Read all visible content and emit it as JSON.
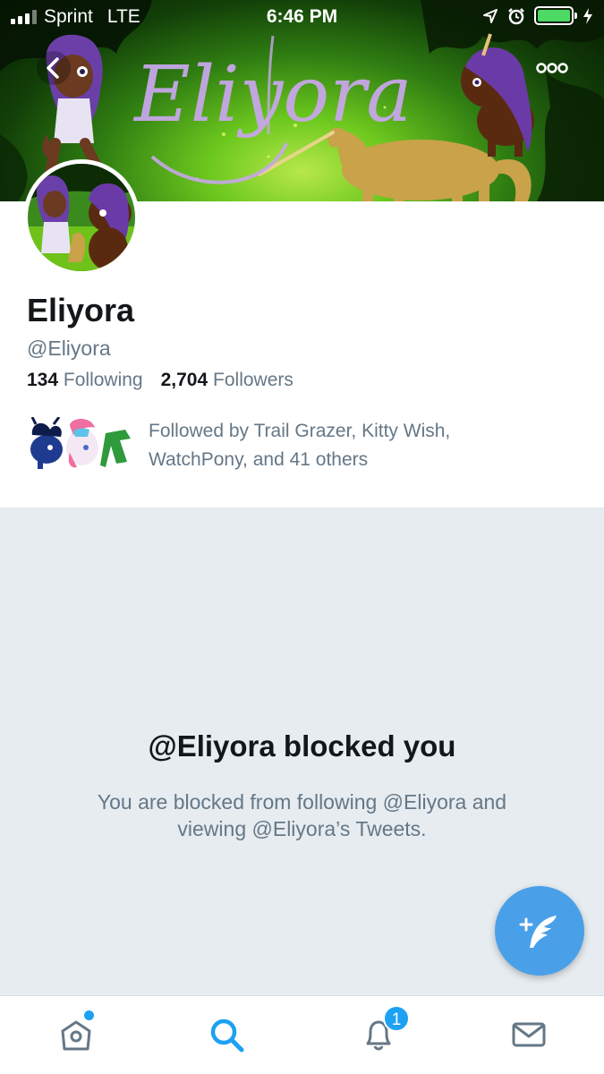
{
  "status_bar": {
    "carrier": "Sprint",
    "network": "LTE",
    "time": "6:46 PM",
    "battery_color": "#4cd964"
  },
  "banner": {
    "title_art": "Eliyora",
    "back_icon": "chevron-left-icon",
    "more_icon": "more-dots-icon"
  },
  "profile": {
    "name": "Eliyora",
    "handle": "@Eliyora",
    "following_count": "134",
    "following_label": "Following",
    "followers_count": "2,704",
    "followers_label": "Followers",
    "followed_by": "Followed by Trail Grazer, Kitty Wish, WatchPony, and 41 others"
  },
  "blocked": {
    "title": "@Eliyora blocked you",
    "description": "You are blocked from following @Eliyora and viewing @Eliyora’s Tweets."
  },
  "compose": {
    "icon": "compose-tweet-icon",
    "color": "#4a9fe9"
  },
  "tabbar": {
    "tabs": [
      {
        "name": "home",
        "icon": "home-icon",
        "active": false,
        "has_dot": true
      },
      {
        "name": "search",
        "icon": "search-icon",
        "active": true
      },
      {
        "name": "notifications",
        "icon": "bell-icon",
        "active": false,
        "badge": "1"
      },
      {
        "name": "messages",
        "icon": "mail-icon",
        "active": false
      }
    ],
    "active_color": "#1da1f2",
    "inactive_color": "#657786"
  }
}
